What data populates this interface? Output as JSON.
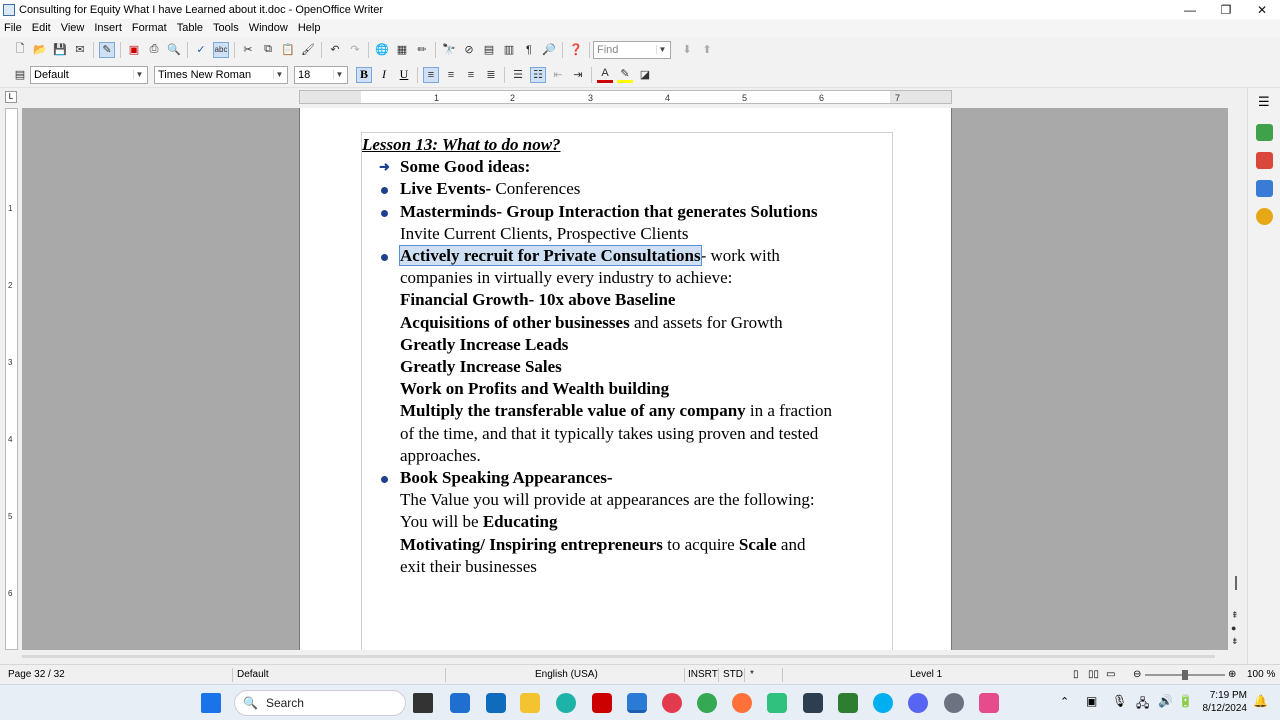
{
  "window": {
    "title": "Consulting for Equity What I have Learned about it.doc - OpenOffice Writer",
    "minimize": "—",
    "maximize": "❐",
    "close": "✕"
  },
  "menu": [
    "File",
    "Edit",
    "View",
    "Insert",
    "Format",
    "Table",
    "Tools",
    "Window",
    "Help"
  ],
  "toolbar": {
    "find_placeholder": "Find",
    "paragraph_style": "Default",
    "font_name": "Times New Roman",
    "font_size": "18",
    "bold": "B",
    "italic": "I",
    "underline": "U"
  },
  "ruler": {
    "ticks": [
      "1",
      "2",
      "3",
      "4",
      "5",
      "6",
      "7"
    ],
    "vticks": [
      "1",
      "2",
      "3",
      "4",
      "5",
      "6"
    ]
  },
  "document": {
    "heading": "Lesson 13: What to do now?",
    "lines": {
      "l1": "Some Good ideas:",
      "l2a": "Live Events-",
      "l2b": " Conferences",
      "l3": "Masterminds- Group Interaction  that generates Solutions",
      "l4": "Invite Current Clients, Prospective Clients",
      "l5a": "Actively recruit for Private Consultations",
      "l5b": "- work with",
      "l6": "companies in virtually every industry to achieve:",
      "l7": "Financial Growth- 10x above Baseline",
      "l8a": "Acquisitions of other businesses",
      "l8b": " and assets for Growth",
      "l9": "Greatly Increase Leads",
      "l10": "Greatly Increase Sales",
      "l11": "Work on Profits and Wealth building",
      "l12a": "Multiply the transferable value of any company",
      "l12b": " in a fraction",
      "l13": "of the time, and  that it typically takes using proven and tested",
      "l14": "approaches.",
      "l15": "Book Speaking Appearances-",
      "l16": "The Value you will provide at appearances are the following:",
      "l17a": "You will be ",
      "l17b": "Educating",
      "l18a": "Motivating/ Inspiring entrepreneurs",
      "l18b": " to acquire  ",
      "l18c": "Scale",
      "l18d": " and",
      "l19": "exit their businesses"
    }
  },
  "status": {
    "page": "Page 32 / 32",
    "style": "Default",
    "language": "English (USA)",
    "insert_mode": "INSRT",
    "selection_mode": "STD",
    "modified": "*",
    "level": "Level 1",
    "zoom": "100 %"
  },
  "taskbar": {
    "search_label": "Search",
    "time": "7:19 PM",
    "date": "8/12/2024"
  },
  "colors": {
    "accent": "#1f3f8f",
    "selection": "#cfe0f5"
  }
}
